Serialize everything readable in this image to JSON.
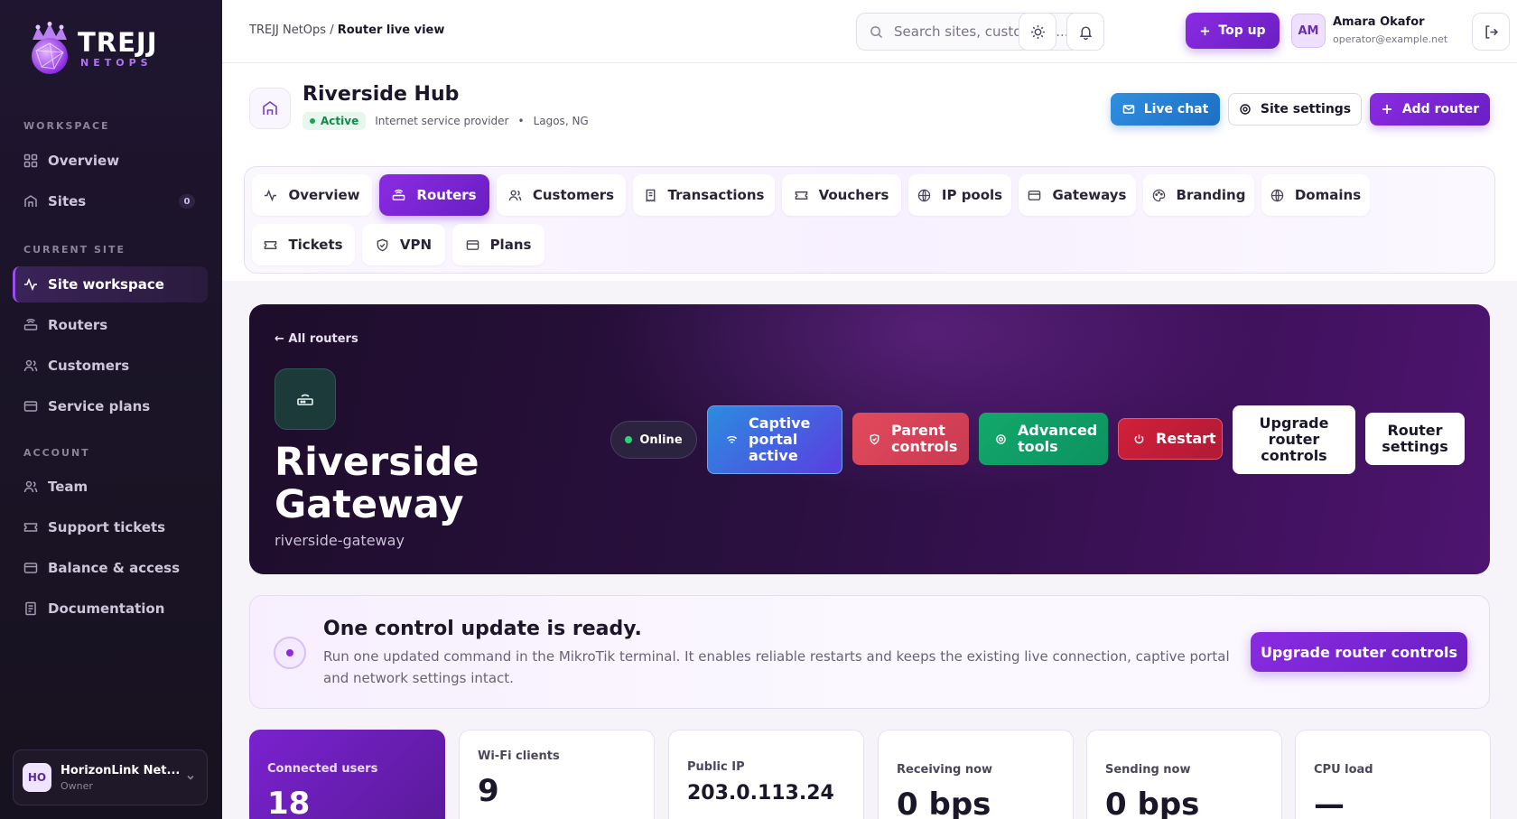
{
  "brand": {
    "name": "TREJJ",
    "sub": "NETOPS"
  },
  "sidebar": {
    "sections": {
      "workspace": "WORKSPACE",
      "current_site": "CURRENT SITE",
      "account": "ACCOUNT"
    },
    "items": [
      {
        "label": "Overview"
      },
      {
        "label": "Sites",
        "badge": "0"
      },
      {
        "label": "Site workspace"
      },
      {
        "label": "Routers"
      },
      {
        "label": "Customers"
      },
      {
        "label": "Service plans"
      },
      {
        "label": "Team"
      },
      {
        "label": "Support tickets"
      },
      {
        "label": "Balance & access"
      },
      {
        "label": "Documentation"
      }
    ],
    "account": {
      "initials": "HO",
      "name": "HorizonLink Net...",
      "role": "Owner"
    }
  },
  "topbar": {
    "breadcrumb_root": "TREJJ NetOps",
    "breadcrumb_sep": " / ",
    "breadcrumb_current": "Router live view",
    "search_placeholder": "Search sites, customers...",
    "topup_label": "Top up",
    "user": {
      "initials": "AM",
      "name": "Amara Okafor",
      "email": "operator@example.net"
    }
  },
  "site": {
    "title": "Riverside Hub",
    "status": "Active",
    "type": "Internet service provider",
    "separator": "•",
    "location": "Lagos, NG",
    "buttons": {
      "chat": "Live chat",
      "settings": "Site settings",
      "add": "Add router"
    },
    "tabs": [
      "Overview",
      "Routers",
      "Customers",
      "Transactions",
      "Vouchers",
      "IP pools",
      "Gateways",
      "Branding",
      "Domains",
      "Tickets",
      "VPN",
      "Plans"
    ]
  },
  "router": {
    "back": "← All routers",
    "name": "Riverside Gateway",
    "slug": "riverside-gateway",
    "status": "Online",
    "actions": {
      "captive": "Captive portal active",
      "parent": "Parent controls",
      "advanced": "Advanced tools",
      "restart": "Restart",
      "upgrade": "Upgrade router controls",
      "settings": "Router settings"
    }
  },
  "update": {
    "title": "One control update is ready.",
    "text": "Run one updated command in the MikroTik terminal. It enables reliable restarts and keeps the existing live connection, captive portal and network settings intact.",
    "button": "Upgrade router controls"
  },
  "stats": [
    {
      "label": "Connected users",
      "value": "18"
    },
    {
      "label": "Wi-Fi clients",
      "value": "9"
    },
    {
      "label": "Public IP",
      "value": "203.0.113.24"
    },
    {
      "label": "Receiving now",
      "value": "0 bps"
    },
    {
      "label": "Sending now",
      "value": "0 bps"
    },
    {
      "label": "CPU load",
      "value": "—"
    }
  ],
  "colors": {
    "accent": "#8a2be2",
    "sidebar_bg": "#1b1428",
    "hero_bg": "#2a1040",
    "online": "#2bd47a"
  }
}
